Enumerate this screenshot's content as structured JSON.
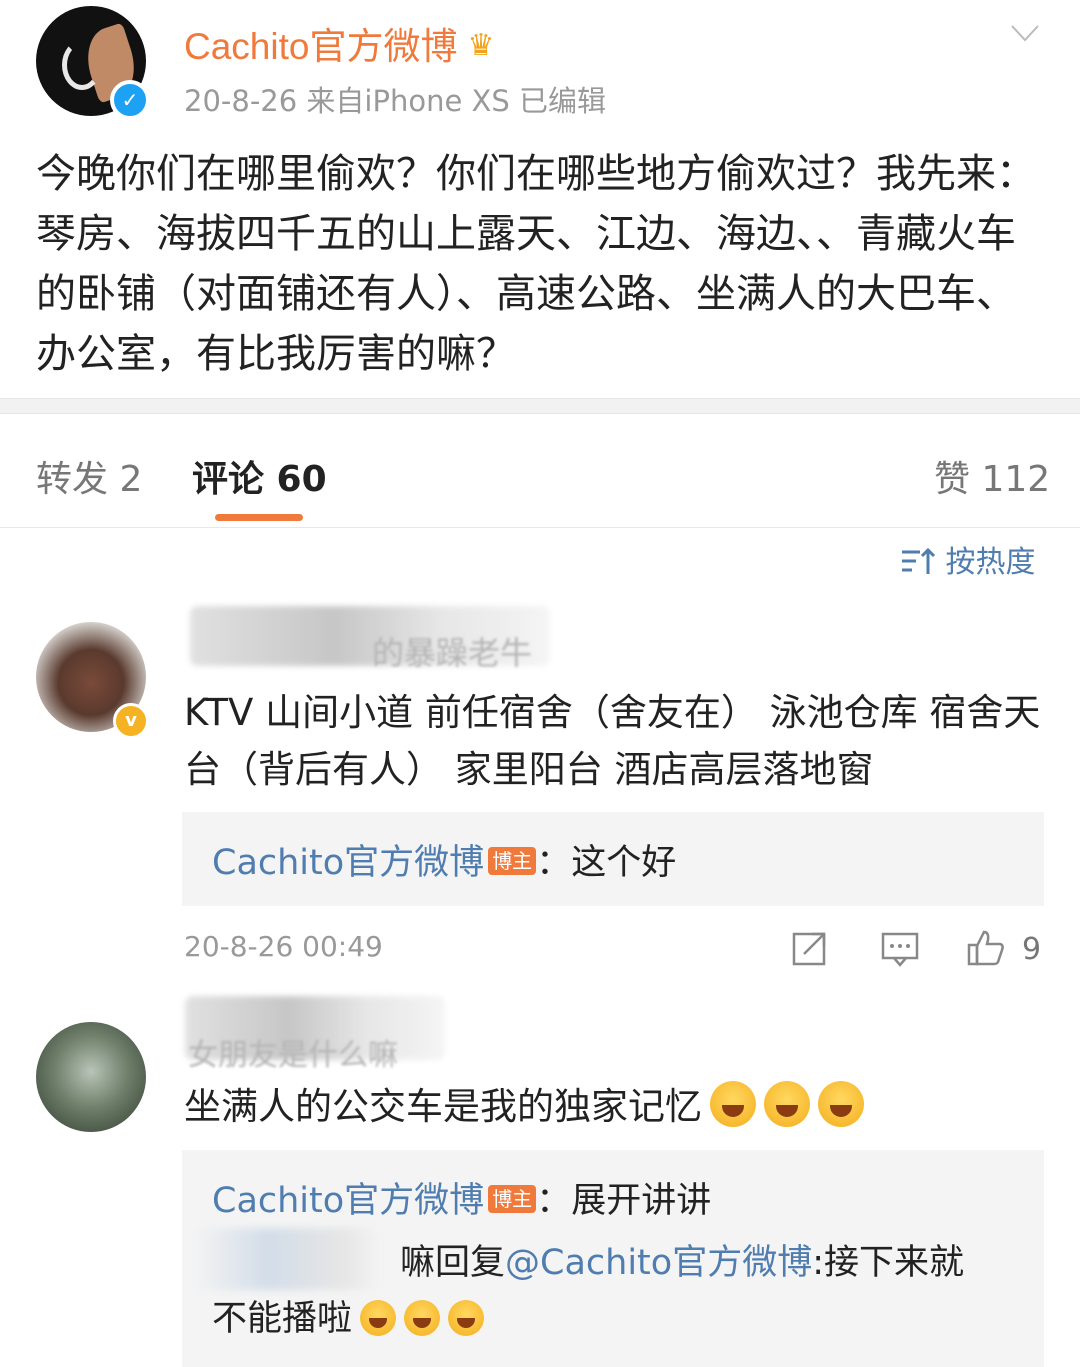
{
  "post": {
    "username": "Cachito官方微博",
    "meta": "20-8-26  来自iPhone XS  已编辑",
    "text": "今晚你们在哪里偷欢？你们在哪些地方偷欢过？我先来：琴房、海拔四千五的山上露天、江边、海边、、青藏火车的卧铺（对面铺还有人）、高速公路、坐满人的大巴车、办公室，有比我厉害的嘛？"
  },
  "tabs": {
    "repost": "转发 2",
    "comments": "评论 60",
    "likes": "赞 112"
  },
  "sort": {
    "label": "按热度"
  },
  "comments": [
    {
      "blurred_name": "的暴躁老牛",
      "text": "KTV 山间小道 前任宿舍（舍友在） 泳池仓库 宿舍天台（背后有人） 家里阳台 酒店高层落地窗",
      "reply": {
        "author": "Cachito官方微博",
        "badge": "博主",
        "text": "：这个好"
      },
      "time": "20-8-26 00:49",
      "likes": "9"
    },
    {
      "blurred_name": "女朋友是什么嘛",
      "text": "坐满人的公交车是我的独家记忆",
      "reply": {
        "author": "Cachito官方微博",
        "badge": "博主",
        "text": "：展开讲讲"
      },
      "reply2": {
        "prefix": "嘛回复",
        "mention": "@Cachito官方微博",
        "text_line1": ":接下来就",
        "text_line2": "不能播啦"
      }
    }
  ],
  "colors": {
    "accent": "#f07a3c",
    "link": "#507daf",
    "verified_blue": "#1da1f2",
    "verified_gold": "#f5b324"
  }
}
